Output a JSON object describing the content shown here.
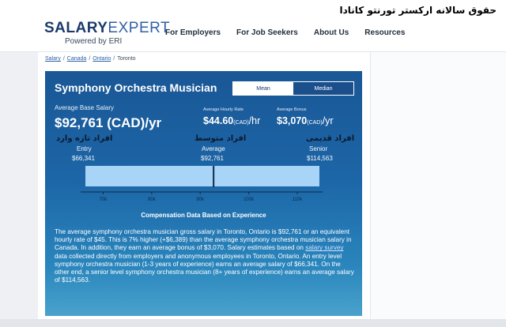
{
  "overlay_title": "حقوق سالانه ارکستر تورنتو کانادا",
  "header": {
    "logo_salary": "SALARY",
    "logo_expert": "EXPERT",
    "logo_tagline": "Powered by ERI",
    "nav": [
      "For Employers",
      "For Job Seekers",
      "About Us",
      "Resources"
    ]
  },
  "breadcrumb": [
    "Salary",
    "Canada",
    "Ontario",
    "Toronto"
  ],
  "card": {
    "title": "Symphony Orchestra Musician",
    "toggle": {
      "mean": "Mean",
      "median": "Median",
      "selected": "Mean"
    },
    "avg_base_label": "Average Base Salary",
    "avg_base_value": "$92,761",
    "avg_base_unit": "(CAD)/yr",
    "hourly_label": "Average Hourly Rate",
    "hourly_value": "$44.60",
    "hourly_unit": "(CAD)",
    "hourly_per": "/hr",
    "bonus_label": "Average Bonus",
    "bonus_value": "$3,070",
    "bonus_unit": "(CAD)",
    "bonus_per": "/yr",
    "levels": {
      "entry": {
        "fa": "افراد تازه وارد",
        "label": "Entry",
        "value": "$66,341"
      },
      "average": {
        "fa": "افراد متوسط",
        "label": "Average",
        "value": "$92,761"
      },
      "senior": {
        "fa": "افراد قدیمی",
        "label": "Senior",
        "value": "$114,563"
      }
    },
    "comp_title": "Compensation Data Based on Experience",
    "desc_1": "The average symphony orchestra musician gross salary in Toronto, Ontario is $92,761 or an equivalent hourly rate of $45. This is 7% higher (+$6,389) than the average symphony orchestra musician salary in Canada. In addition, they earn an average bonus of $3,070. Salary estimates based on ",
    "desc_link": "salary survey",
    "desc_2": " data collected directly from employers and anonymous employees in Toronto, Ontario. An entry level symphony orchestra musician (1-3 years of experience) earns an average salary of $66,341. On the other end, a senior level symphony orchestra musician (8+ years of experience) earns an average salary of $114,563."
  },
  "chart_data": {
    "type": "bar",
    "title": "",
    "ticks": [
      "70k",
      "80k",
      "90k",
      "100k",
      "110k"
    ],
    "tick_values": [
      70000,
      80000,
      90000,
      100000,
      110000
    ],
    "xlim": [
      66341,
      114563
    ],
    "range": {
      "min": 66341,
      "average": 92761,
      "max": 114563
    },
    "colors": {
      "bar": "#a8d4f7",
      "marker": "#0d2a4a",
      "axis": "#0d2a4a"
    }
  }
}
